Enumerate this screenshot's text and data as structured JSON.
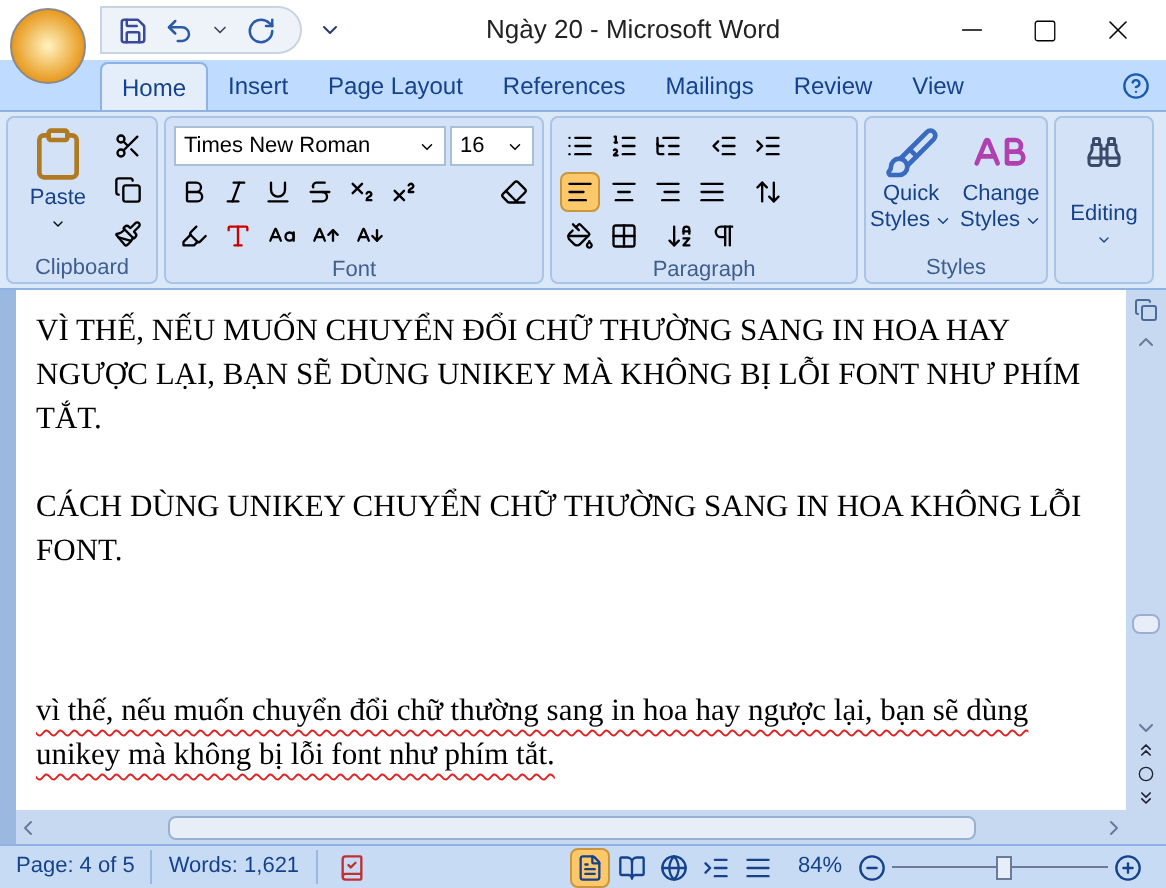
{
  "window": {
    "title": "Ngày 20 - Microsoft Word"
  },
  "tabs": [
    {
      "label": "Home",
      "selected": true
    },
    {
      "label": "Insert",
      "selected": false
    },
    {
      "label": "Page Layout",
      "selected": false
    },
    {
      "label": "References",
      "selected": false
    },
    {
      "label": "Mailings",
      "selected": false
    },
    {
      "label": "Review",
      "selected": false
    },
    {
      "label": "View",
      "selected": false
    }
  ],
  "ribbon": {
    "clipboard": {
      "label": "Clipboard",
      "paste": "Paste"
    },
    "font": {
      "label": "Font",
      "font_name": "Times New Roman",
      "font_size": "16"
    },
    "paragraph": {
      "label": "Paragraph",
      "alignments": [
        {
          "kind": "left",
          "selected": true
        },
        {
          "kind": "center",
          "selected": false
        },
        {
          "kind": "right",
          "selected": false
        },
        {
          "kind": "justify",
          "selected": false
        }
      ]
    },
    "styles": {
      "label": "Styles",
      "quick_styles": [
        "Quick",
        "Styles"
      ],
      "change_styles": [
        "Change",
        "Styles"
      ]
    },
    "editing": {
      "label": "Editing"
    }
  },
  "document": {
    "paragraphs": [
      {
        "text": "VÌ THẾ, NẾU MUỐN CHUYỂN ĐỔI CHỮ THƯỜNG SANG IN HOA HAY NGƯỢC LẠI, BẠN SẼ DÙNG UNIKEY MÀ KHÔNG BỊ LỖI FONT NHƯ PHÍM TẮT.",
        "spell_errors": false
      },
      {
        "text": "CÁCH DÙNG UNIKEY CHUYỂN CHỮ THƯỜNG SANG IN HOA KHÔNG LỖI FONT.",
        "spell_errors": false
      },
      {
        "text": "vì thế, nếu muốn chuyển đổi chữ thường sang in hoa hay ngược lại, bạn sẽ dùng unikey mà không bị lỗi font như phím tắt.",
        "spell_errors": true
      }
    ]
  },
  "status_bar": {
    "page": "Page: 4 of 5",
    "words": "Words: 1,621",
    "views": [
      {
        "selected": true
      },
      {
        "selected": false
      },
      {
        "selected": false
      },
      {
        "selected": false
      },
      {
        "selected": false
      }
    ],
    "zoom": "84%",
    "zoom_slider": {
      "level": 0.52
    }
  }
}
